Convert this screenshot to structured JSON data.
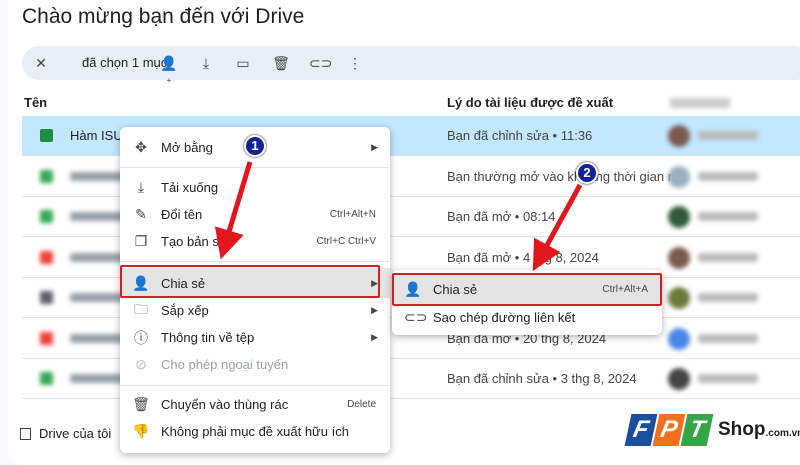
{
  "page_title": "Chào mừng bạn đến với Drive",
  "toolbar": {
    "selected_label": "đã chọn 1 mục",
    "icons": [
      "close-icon",
      "share-icon",
      "download-icon",
      "move-icon",
      "trash-icon",
      "link-icon",
      "more-icon"
    ]
  },
  "table": {
    "headers": {
      "name": "Tên",
      "reason": "Lý do tài liệu được đề xuất"
    },
    "rows": [
      {
        "name": "Hàm ISUI",
        "reason": "Bạn đã chỉnh sửa • 11:36",
        "color": "#1e8e3e"
      },
      {
        "reason": "Bạn thường mở vào khoảng thời gian n...",
        "color": "#34a853"
      },
      {
        "reason": "Bạn đã mở • 08:14",
        "color": "#34a853"
      },
      {
        "reason": "Bạn đã mở • 4 thg 8, 2024",
        "color": "#ea4335"
      },
      {
        "reason": "",
        "color": "#5f6368"
      },
      {
        "reason": "Bạn đã mở • 20 thg 8, 2024",
        "color": "#ea4335"
      },
      {
        "reason": "Bạn đã chỉnh sửa • 3 thg 8, 2024",
        "color": "#34a853"
      }
    ]
  },
  "context_menu": {
    "items": [
      {
        "label": "Mở bằng"
      },
      {
        "label": "Tải xuống"
      },
      {
        "label": "Đổi tên",
        "shortcut": "Ctrl+Alt+N"
      },
      {
        "label": "Tạo bản sao",
        "shortcut": "Ctrl+C Ctrl+V"
      },
      {
        "label": "Chia sẻ"
      },
      {
        "label": "Sắp xếp"
      },
      {
        "label": "Thông tin về tệp"
      },
      {
        "label": "Cho phép ngoại tuyến"
      },
      {
        "label": "Chuyển vào thùng rác",
        "shortcut": "Delete"
      },
      {
        "label": "Không phải mục đề xuất hữu ích"
      }
    ]
  },
  "submenu": {
    "items": [
      {
        "label": "Chia sẻ",
        "shortcut": "Ctrl+Alt+A"
      },
      {
        "label": "Sao chép đường liên kết"
      }
    ]
  },
  "annotations": {
    "step1": "1",
    "step2": "2"
  },
  "footer": {
    "my_drive": "Drive của tôi"
  },
  "brand": {
    "letters": [
      "F",
      "P",
      "T"
    ],
    "shop": "Shop",
    ".com.vn": ".com.vn",
    "domain": ".com.vn"
  },
  "colors": {
    "selected_row": "#c2e7ff",
    "highlight_box": "#d32027",
    "badge": "#12239a"
  }
}
